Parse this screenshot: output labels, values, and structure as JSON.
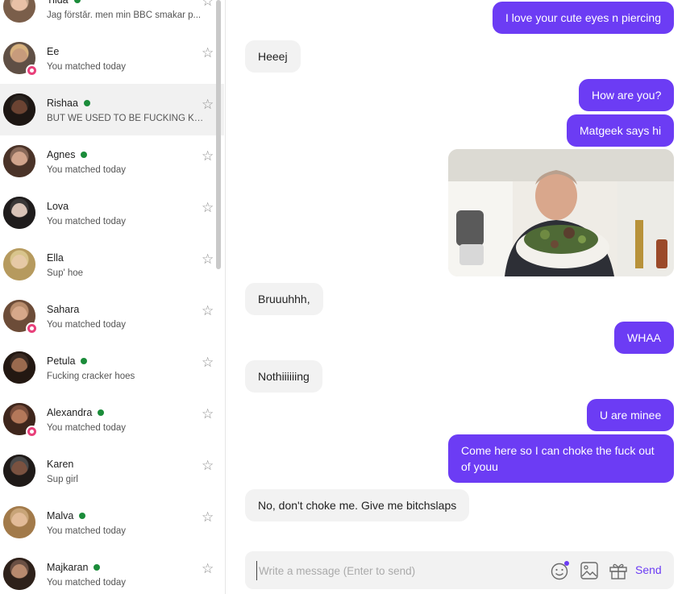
{
  "conversations": [
    {
      "name": "Tilda",
      "preview": "Jag förstår. men min BBC smakar p...",
      "online": true,
      "matched_badge": false,
      "active": false,
      "avatar": {
        "bg": "#c6a78e",
        "skin": "#e8c0a6",
        "hair": "#7a5e4a"
      }
    },
    {
      "name": "Ee",
      "preview": "You matched today",
      "online": false,
      "matched_badge": true,
      "active": false,
      "avatar": {
        "bg": "#d7b17e",
        "skin": "#c79b7c",
        "hair": "#5f4f45"
      }
    },
    {
      "name": "Rishaa",
      "preview": "BUT WE USED TO BE FUCKING KAN...",
      "online": true,
      "matched_badge": false,
      "active": true,
      "avatar": {
        "bg": "#2a2420",
        "skin": "#6b4332",
        "hair": "#1d1613"
      }
    },
    {
      "name": "Agnes",
      "preview": "You matched today",
      "online": true,
      "matched_badge": false,
      "active": false,
      "avatar": {
        "bg": "#8a6a5a",
        "skin": "#d1a48c",
        "hair": "#4a3328"
      }
    },
    {
      "name": "Lova",
      "preview": "You matched today",
      "online": false,
      "matched_badge": false,
      "active": false,
      "avatar": {
        "bg": "#3a3838",
        "skin": "#d9c4b8",
        "hair": "#1f1c1c"
      }
    },
    {
      "name": "Ella",
      "preview": "Sup' hoe",
      "online": false,
      "matched_badge": false,
      "active": false,
      "avatar": {
        "bg": "#d8c48c",
        "skin": "#e6c9a6",
        "hair": "#b69a5e"
      }
    },
    {
      "name": "Sahara",
      "preview": "You matched today",
      "online": false,
      "matched_badge": true,
      "active": false,
      "avatar": {
        "bg": "#b88c6c",
        "skin": "#d6a88a",
        "hair": "#6c4c38"
      }
    },
    {
      "name": "Petula",
      "preview": "Fucking cracker hoes",
      "online": true,
      "matched_badge": false,
      "active": false,
      "avatar": {
        "bg": "#3a2a22",
        "skin": "#9a6a4e",
        "hair": "#231812"
      }
    },
    {
      "name": "Alexandra",
      "preview": "You matched today",
      "online": true,
      "matched_badge": true,
      "active": false,
      "avatar": {
        "bg": "#7a4e3c",
        "skin": "#b4785a",
        "hair": "#3e261c"
      }
    },
    {
      "name": "Karen",
      "preview": "Sup girl",
      "online": false,
      "matched_badge": false,
      "active": false,
      "avatar": {
        "bg": "#4a4a4a",
        "skin": "#7a5240",
        "hair": "#1f1a18"
      }
    },
    {
      "name": "Malva",
      "preview": "You matched today",
      "online": true,
      "matched_badge": false,
      "active": false,
      "avatar": {
        "bg": "#c8a478",
        "skin": "#e2bb98",
        "hair": "#a27a4a"
      }
    },
    {
      "name": "Majkaran",
      "preview": "You matched today",
      "online": true,
      "matched_badge": false,
      "active": false,
      "avatar": {
        "bg": "#6a5044",
        "skin": "#b88a6e",
        "hair": "#2e211a"
      }
    }
  ],
  "messages": [
    {
      "side": "out",
      "text": "I love your cute eyes n piercing"
    },
    {
      "side": "in",
      "text": "Heeej"
    },
    {
      "side": "out",
      "text": "How are you?"
    },
    {
      "side": "out",
      "text": "Matgeek says hi"
    },
    {
      "side": "out",
      "type": "image",
      "text": ""
    },
    {
      "side": "in",
      "text": "Bruuuhhh,"
    },
    {
      "side": "out",
      "text": "WHAA"
    },
    {
      "side": "in",
      "text": "Nothiiiiiing"
    },
    {
      "side": "out",
      "text": "U are minee"
    },
    {
      "side": "out",
      "text": "Come here so I can choke the fuck out of youu"
    },
    {
      "side": "in",
      "text": "No, don't choke me. Give me bitchslaps"
    }
  ],
  "composer": {
    "placeholder": "Write a message (Enter to send)",
    "value": "",
    "send_label": "Send",
    "icons": [
      "emoji-icon",
      "image-icon",
      "gift-icon"
    ]
  },
  "colors": {
    "accent": "#6c3cf4",
    "online": "#1b8c3a",
    "match_badge": "#e8407a",
    "incoming_bubble": "#f2f2f2"
  }
}
